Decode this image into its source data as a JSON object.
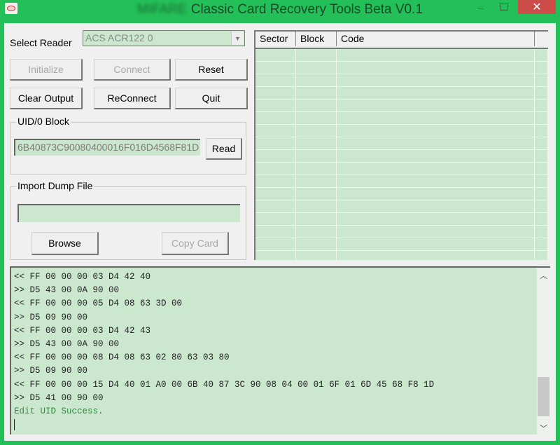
{
  "window": {
    "title_blurred": "MIFARE",
    "title": "Classic Card Recovery Tools Beta V0.1",
    "minimize_glyph": "–",
    "close_glyph": "✕",
    "app_icon": "card-app-icon"
  },
  "reader": {
    "label": "Select Reader",
    "selected": "ACS ACR122 0",
    "dropdown_glyph": "▼"
  },
  "buttons": {
    "initialize": {
      "label": "Initialize",
      "enabled": false
    },
    "connect": {
      "label": "Connect",
      "enabled": false
    },
    "reset": {
      "label": "Reset",
      "enabled": true
    },
    "clear_output": {
      "label": "Clear Output",
      "enabled": true
    },
    "reconnect": {
      "label": "ReConnect",
      "enabled": true
    },
    "quit": {
      "label": "Quit",
      "enabled": true
    }
  },
  "uid_block": {
    "group_label": "UID/0 Block",
    "value": "6B40873C90080400016F016D4568F81D",
    "read_label": "Read"
  },
  "import_dump": {
    "group_label": "Import Dump File",
    "path_value": "",
    "browse_label": "Browse",
    "copy_card_label": "Copy Card",
    "copy_card_enabled": false
  },
  "sector_table": {
    "columns": [
      "Sector",
      "Block",
      "Code"
    ],
    "rows": []
  },
  "log": {
    "lines": [
      {
        "text": "<< FF 00 00 00 03 D4 42 40",
        "type": "normal"
      },
      {
        "text": ">> D5 43 00 0A 90 00",
        "type": "normal"
      },
      {
        "text": "<< FF 00 00 00 05 D4 08 63 3D 00",
        "type": "normal"
      },
      {
        "text": ">> D5 09 90 00",
        "type": "normal"
      },
      {
        "text": "<< FF 00 00 00 03 D4 42 43",
        "type": "normal"
      },
      {
        "text": ">> D5 43 00 0A 90 00",
        "type": "normal"
      },
      {
        "text": "<< FF 00 00 00 08 D4 08 63 02 80 63 03 80",
        "type": "normal"
      },
      {
        "text": ">> D5 09 90 00",
        "type": "normal"
      },
      {
        "text": "<< FF 00 00 00 15 D4 40 01 A0 00 6B 40 87 3C 90 08 04 00 01 6F 01 6D 45 68 F8 1D",
        "type": "normal"
      },
      {
        "text": ">> D5 41 00 90 00",
        "type": "normal"
      },
      {
        "text": "Edit UID Success.",
        "type": "success"
      }
    ],
    "scroll_up_glyph": "︿",
    "scroll_down_glyph": "﹀"
  }
}
